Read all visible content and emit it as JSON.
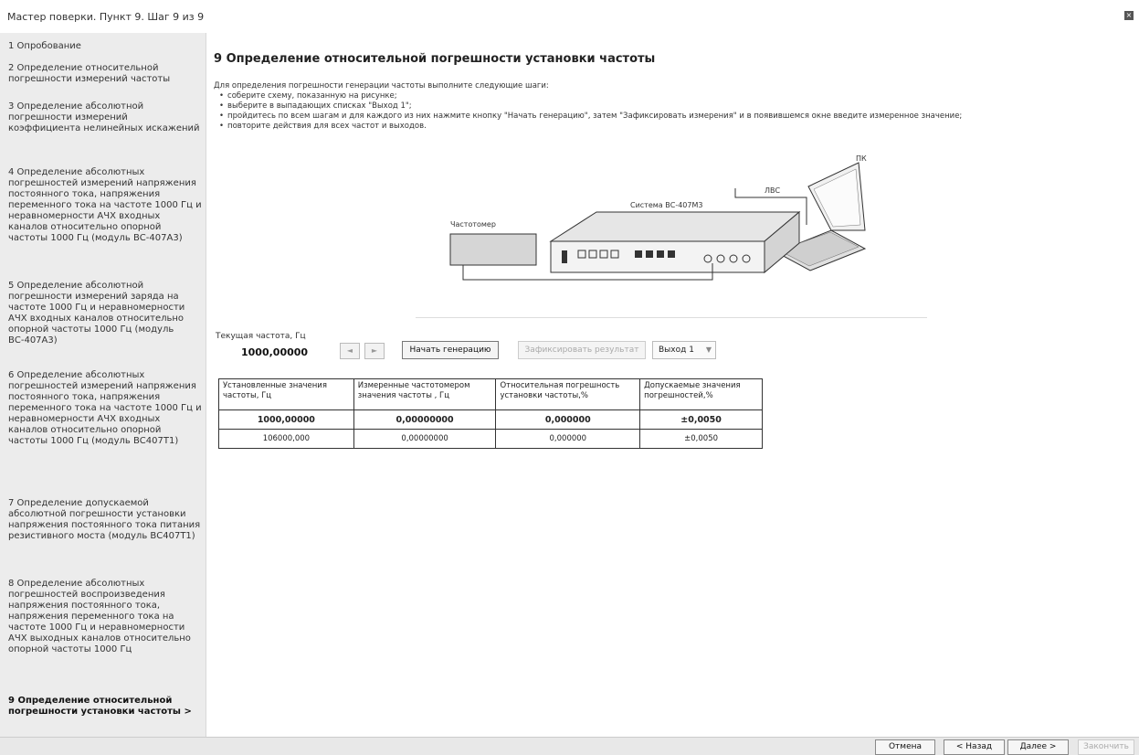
{
  "window": {
    "title": "Мастер поверки. Пункт 9. Шаг 9 из 9",
    "close_icon": "close-icon"
  },
  "sidebar": {
    "items": [
      {
        "label": "1 Опробование"
      },
      {
        "label": "2 Определение относительной погрешности измерений частоты"
      },
      {
        "label": "3 Определение абсолютной погрешности измерений коэффициента нелинейных искажений"
      },
      {
        "label": "4 Определение абсолютных погрешностей измерений напряжения постоянного тока, напряжения переменного тока на частоте 1000 Гц и неравномерности АЧХ входных каналов относительно опорной частоты 1000 Гц (модуль ВС-407А3)"
      },
      {
        "label": "5 Определение абсолютной погрешности измерений заряда на частоте 1000 Гц и неравномерности АЧХ входных каналов относительно опорной частоты 1000 Гц (модуль ВС-407А3)"
      },
      {
        "label": "6 Определение абсолютных погрешностей измерений напряжения постоянного тока, напряжения переменного тока на частоте 1000 Гц и неравномерности АЧХ входных каналов относительно опорной частоты 1000 Гц (модуль ВС407Т1)"
      },
      {
        "label": "7 Определение допускаемой абсолютной погрешности установки напряжения постоянного тока питания резистивного моста (модуль ВС407Т1)"
      },
      {
        "label": "8 Определение абсолютных погрешностей воспроизведения напряжения постоянного тока, напряжения переменного тока на частоте 1000 Гц и неравномерности АЧХ выходных каналов относительно опорной частоты 1000 Гц"
      },
      {
        "label": "9 Определение относительной погрешности установки частоты >"
      }
    ]
  },
  "main": {
    "title": "9 Определение относительной погрешности установки частоты",
    "intro": "Для определения погрешности генерации частоты выполните следующие шаги:",
    "steps": [
      "соберите схему, показанную на рисунке;",
      "выберите в выпадающих списках \"Выход 1\";",
      "пройдитесь по всем шагам и для каждого из них нажмите кнопку \"Начать генерацию\", затем \"Зафиксировать измерения\" и в появившемся окне введите измеренное значение;",
      "повторите действия для всех частот и выходов."
    ]
  },
  "diagram": {
    "pc_label": "ПК",
    "lan_label": "ЛВС",
    "system_label": "Система ВС-407М3",
    "counter_label": "Частотомер"
  },
  "controls": {
    "freq_label": "Текущая частота, Гц",
    "freq_value": "1000,00000",
    "start_button": "Начать генерацию",
    "fix_button": "Зафиксировать результат",
    "output_select": "Выход 1"
  },
  "table": {
    "headers": [
      "Установленные значения частоты, Гц",
      "Измеренные частотомером значения частоты , Гц",
      "Относительная погрешность установки частоты,%",
      "Допускаемые значения погрешностей,%"
    ],
    "rows": [
      [
        "1000,00000",
        "0,00000000",
        "0,000000",
        "±0,0050"
      ],
      [
        "106000,000",
        "0,00000000",
        "0,000000",
        "±0,0050"
      ]
    ]
  },
  "footer": {
    "cancel": "Отмена",
    "back": "< Назад",
    "next": "Далее >",
    "finish": "Закончить"
  }
}
